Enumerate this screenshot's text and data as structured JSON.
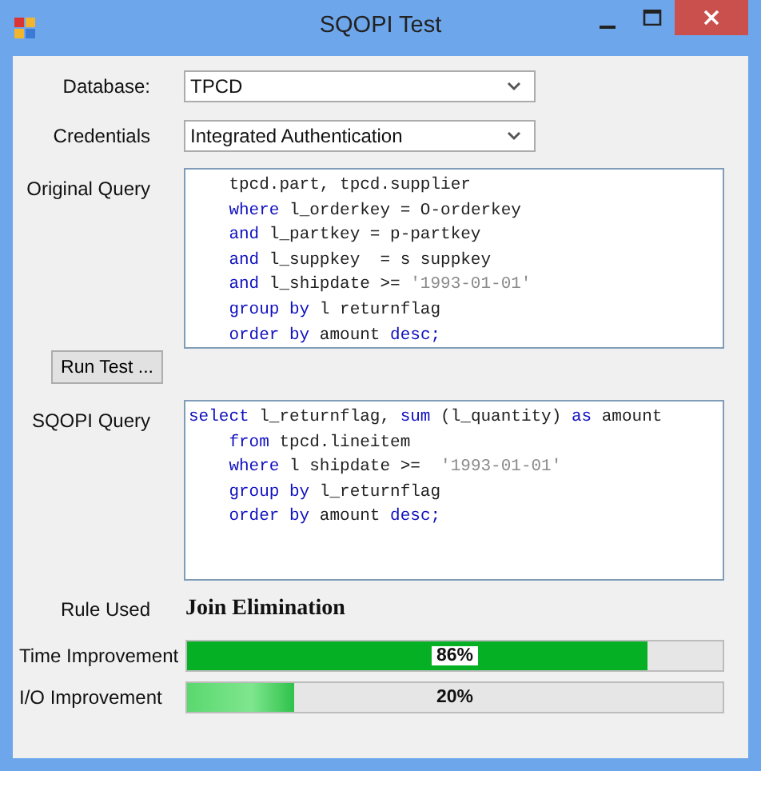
{
  "window": {
    "title": "SQOPI Test"
  },
  "database": {
    "label": "Database:",
    "value": "TPCD"
  },
  "credentials": {
    "label": "Credentials",
    "value": "Integrated Authentication"
  },
  "original_query": {
    "label": "Original Query",
    "lines": [
      [
        {
          "kind": "plain",
          "text": "    tpcd.part, tpcd.supplier"
        }
      ],
      [
        {
          "kind": "keyword",
          "text": "    where"
        },
        {
          "kind": "plain",
          "text": " l_orderkey = O-orderkey"
        }
      ],
      [
        {
          "kind": "keyword",
          "text": "    and"
        },
        {
          "kind": "plain",
          "text": " l_partkey = p-partkey"
        }
      ],
      [
        {
          "kind": "keyword",
          "text": "    and"
        },
        {
          "kind": "plain",
          "text": " l_suppkey  = s suppkey"
        }
      ],
      [
        {
          "kind": "keyword",
          "text": "    and"
        },
        {
          "kind": "plain",
          "text": " l_shipdate >= "
        },
        {
          "kind": "string",
          "text": "'1993-01-01'"
        }
      ],
      [
        {
          "kind": "keyword",
          "text": "    group by"
        },
        {
          "kind": "plain",
          "text": " l returnflag"
        }
      ],
      [
        {
          "kind": "keyword",
          "text": "    order by"
        },
        {
          "kind": "plain",
          "text": " amount "
        },
        {
          "kind": "keyword",
          "text": "desc;"
        }
      ]
    ]
  },
  "run_button": "Run Test ...",
  "sqopi_query": {
    "label": "SQOPI Query",
    "lines": [
      [
        {
          "kind": "keyword",
          "text": "select"
        },
        {
          "kind": "plain",
          "text": " l_returnflag, "
        },
        {
          "kind": "keyword",
          "text": "sum"
        },
        {
          "kind": "plain",
          "text": " (l_quantity) "
        },
        {
          "kind": "keyword",
          "text": "as"
        },
        {
          "kind": "plain",
          "text": " amount"
        }
      ],
      [
        {
          "kind": "keyword",
          "text": "    from"
        },
        {
          "kind": "plain",
          "text": " tpcd.lineitem"
        }
      ],
      [
        {
          "kind": "keyword",
          "text": "    where"
        },
        {
          "kind": "plain",
          "text": " l shipdate >=  "
        },
        {
          "kind": "string",
          "text": "'1993-01-01'"
        }
      ],
      [
        {
          "kind": "keyword",
          "text": "    group by"
        },
        {
          "kind": "plain",
          "text": " l_returnflag"
        }
      ],
      [
        {
          "kind": "keyword",
          "text": "    order by"
        },
        {
          "kind": "plain",
          "text": " amount "
        },
        {
          "kind": "keyword",
          "text": "desc;"
        }
      ]
    ]
  },
  "rule": {
    "label": "Rule Used",
    "value": "Join Elimination"
  },
  "meters": [
    {
      "label": "Time Improvement",
      "level": 0.86,
      "reading": "86%"
    },
    {
      "label": "I/O Improvement",
      "level": 0.2,
      "reading": "20%"
    }
  ]
}
